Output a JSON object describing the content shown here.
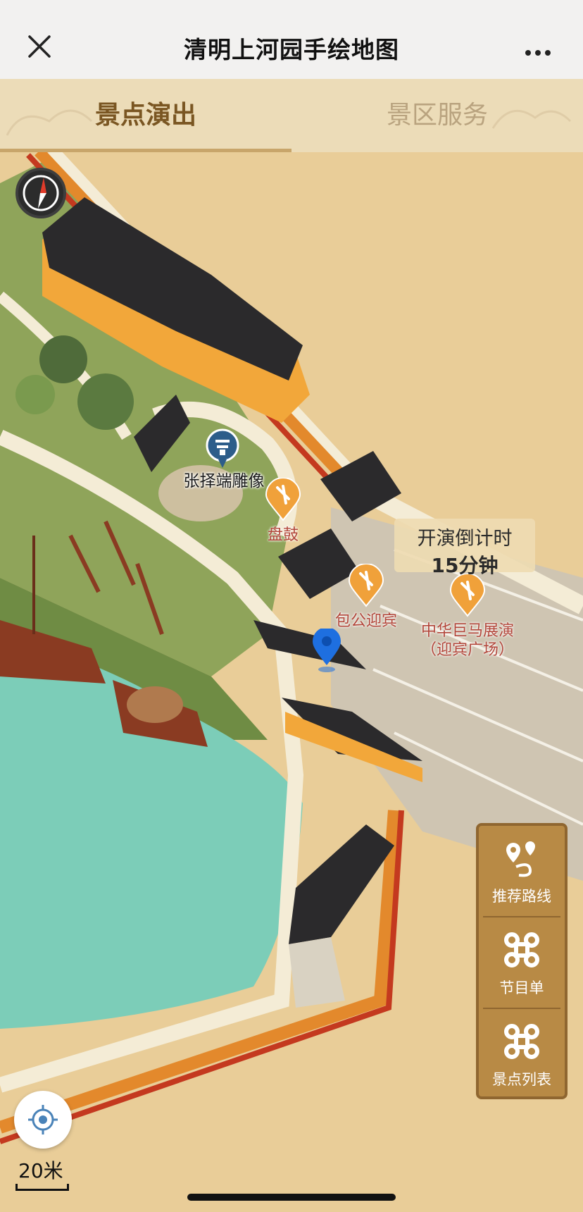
{
  "header": {
    "title": "清明上河园手绘地图",
    "close_icon": "close-icon",
    "more_icon": "more-icon"
  },
  "tabs": [
    {
      "label": "景点演出",
      "active": true
    },
    {
      "label": "景区服务",
      "active": false
    }
  ],
  "map": {
    "compass_icon": "compass-icon",
    "points": [
      {
        "label": "张择端雕像",
        "type": "landmark"
      },
      {
        "label": "盘鼓",
        "type": "performance"
      },
      {
        "label": "包公迎宾",
        "type": "performance"
      },
      {
        "label": "中华巨马展演（迎宾广场）",
        "type": "performance"
      }
    ],
    "current_location_icon": "location-pin-icon"
  },
  "countdown": {
    "label": "开演倒计时",
    "value": "15分钟"
  },
  "side_panel": {
    "buttons": [
      {
        "label": "推荐路线",
        "icon": "route-icon"
      },
      {
        "label": "节目单",
        "icon": "command-icon"
      },
      {
        "label": "景点列表",
        "icon": "command-icon"
      }
    ]
  },
  "locate_icon": "locate-icon",
  "scale": {
    "label": "20米"
  },
  "colors": {
    "accent_brown": "#7a5622",
    "panel_gold": "#b88a45",
    "poi_orange": "#f0a13a",
    "poi_text_red": "#b2463a",
    "location_blue": "#1e6fe0",
    "water": "#7ccdb8",
    "ground": "#e9cd98"
  }
}
